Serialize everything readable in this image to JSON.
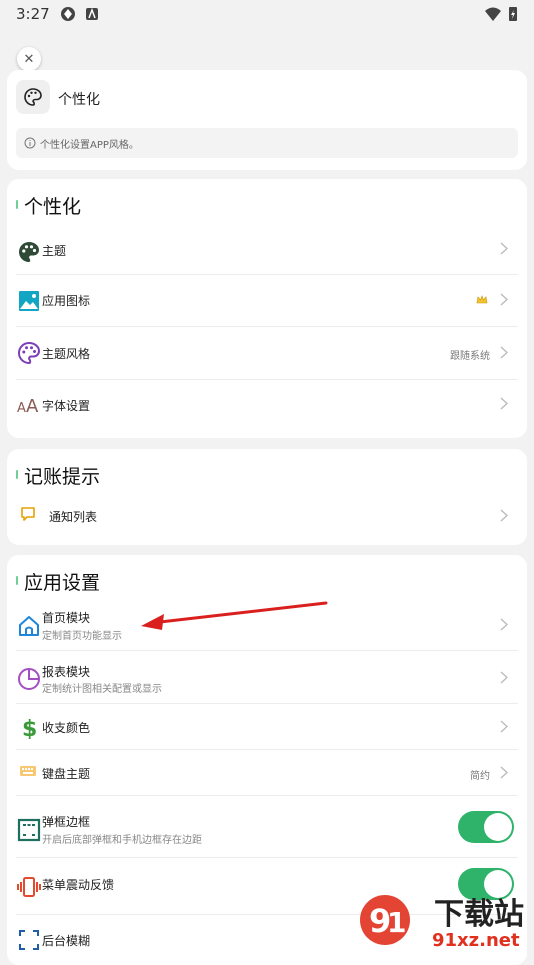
{
  "status_bar": {
    "time": "3:27"
  },
  "header": {
    "title": "个性化",
    "info": "个性化设置APP风格。"
  },
  "sections": [
    {
      "title": "个性化",
      "items": [
        {
          "label": "主题",
          "icon": "palette-icon"
        },
        {
          "label": "应用图标",
          "icon": "image-icon",
          "badge": "crown-icon"
        },
        {
          "label": "主题风格",
          "icon": "palette-outline-icon",
          "value": "跟随系统"
        },
        {
          "label": "字体设置",
          "icon": "font-size-icon"
        }
      ]
    },
    {
      "title": "记账提示",
      "items": [
        {
          "label": "通知列表",
          "icon": "message-icon"
        }
      ]
    },
    {
      "title": "应用设置",
      "items": [
        {
          "label": "首页模块",
          "sub": "定制首页功能显示",
          "icon": "home-icon"
        },
        {
          "label": "报表模块",
          "sub": "定制统计图相关配置或显示",
          "icon": "pie-chart-icon"
        },
        {
          "label": "收支颜色",
          "icon": "dollar-icon"
        },
        {
          "label": "键盘主题",
          "icon": "keyboard-icon",
          "value": "简约"
        },
        {
          "label": "弹框边框",
          "sub": "开启后底部弹框和手机边框存在边距",
          "icon": "frame-icon",
          "toggle": true
        },
        {
          "label": "菜单震动反馈",
          "icon": "vibration-icon",
          "toggle": true
        },
        {
          "label": "后台模糊",
          "icon": "blur-icon"
        }
      ]
    }
  ],
  "watermark": {
    "text": "下载站",
    "domain": "91xz.net"
  },
  "colors": {
    "accent": "#2fb36b",
    "annotation_arrow": "#d9201e"
  }
}
